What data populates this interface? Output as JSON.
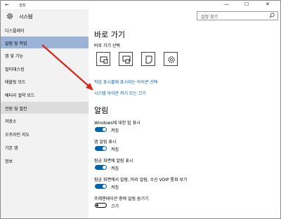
{
  "window": {
    "title": "설정",
    "back_glyph": "←",
    "minimize": "—",
    "maximize": "☐",
    "close": "✕"
  },
  "header": {
    "title": "시스템",
    "search_placeholder": "설정 찾기"
  },
  "sidebar": {
    "items": [
      {
        "label": "디스플레이",
        "state": "normal"
      },
      {
        "label": "알림 및 작업",
        "state": "selected"
      },
      {
        "label": "앱 및 기능",
        "state": "normal"
      },
      {
        "label": "멀티태스킹",
        "state": "normal"
      },
      {
        "label": "태블릿 모드",
        "state": "normal"
      },
      {
        "label": "배터리 절약 모드",
        "state": "normal"
      },
      {
        "label": "전원 및 절전",
        "state": "hover"
      },
      {
        "label": "저장소",
        "state": "normal"
      },
      {
        "label": "오프라인 지도",
        "state": "normal"
      },
      {
        "label": "기본 앱",
        "state": "normal"
      },
      {
        "label": "정보",
        "state": "normal"
      }
    ]
  },
  "quick_actions": {
    "heading": "바로 가기",
    "subheading": "바로 가기 선택",
    "tiles": [
      "tablet-mode-icon",
      "connect-icon",
      "note-icon",
      "settings-gear-icon"
    ],
    "link_taskbar_icons": "작업 표시줄에 표시되는 아이콘 선택",
    "link_system_icons": "시스템 아이콘 켜기 또는 끄기"
  },
  "notifications": {
    "heading": "알림",
    "settings": [
      {
        "label": "Windows에 대한 팁 표시",
        "on": true,
        "state_text": "켜짐"
      },
      {
        "label": "앱 알림 표시",
        "on": true,
        "state_text": "켜짐"
      },
      {
        "label": "잠금 화면에 알림 표시",
        "on": true,
        "state_text": "켜짐"
      },
      {
        "label": "잠금 화면에서 알람, 미리 알림, 수신 VOIP 통화 보기",
        "on": true,
        "state_text": "켜짐"
      },
      {
        "label": "프레젠테이션 중에 알림 숨기기",
        "on": false,
        "state_text": "끄기"
      }
    ]
  },
  "colors": {
    "accent": "#0063b1",
    "selected": "#9ab3d6",
    "link": "#0062b0",
    "annotation": "#d9261c"
  }
}
